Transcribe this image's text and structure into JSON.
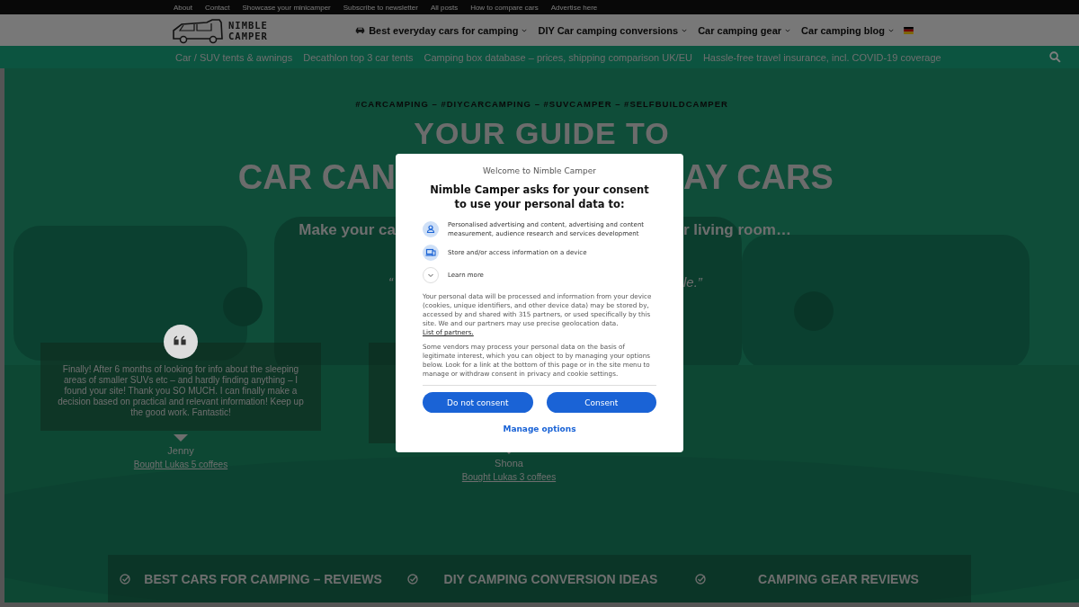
{
  "top_links": [
    "About",
    "Contact",
    "Showcase your minicamper",
    "Subscribe to newsletter",
    "All posts",
    "How to compare cars",
    "Advertise here"
  ],
  "logo": {
    "line1": "NIMBLE",
    "line2": "CAMPER"
  },
  "main_nav": [
    {
      "label": "Best everyday cars for camping",
      "has_icon": true
    },
    {
      "label": "DIY Car camping conversions",
      "has_icon": false
    },
    {
      "label": "Car camping gear",
      "has_icon": false
    },
    {
      "label": "Car camping blog",
      "has_icon": false
    }
  ],
  "sub_nav": [
    "Car / SUV tents & awnings",
    "Decathlon top 3 car tents",
    "Camping box database – prices, shipping comparison UK/EU",
    "Hassle-free travel insurance, incl. COVID-19 coverage"
  ],
  "hero": {
    "hashtags": "#CARCAMPING – #DIYCARCAMPING – #SUVCAMPER – #SELFBUILDCAMPER",
    "title_line1": "YOUR GUIDE TO",
    "title_line2_left": "CAR CAN",
    "title_line2_right": "AY CARS",
    "subtitle_left": "Make your ca",
    "subtitle_right": "r living room…",
    "quote_left": "“",
    "quote_right": "le.”"
  },
  "testimonials": [
    {
      "text": "Finally! After 6 months of looking for info about the sleeping areas of smaller SUVs etc – and hardly finding anything – I found your site! Thank you SO MUCH. I can finally make a decision based on practical and relevant information! Keep up the good work. Fantastic!",
      "author": "Jenny",
      "link": "Bought Lukas 5 coffees"
    },
    {
      "author": "Shona",
      "link": "Bought Lukas 3 coffees"
    }
  ],
  "features": [
    "BEST CARS FOR CAMPING – REVIEWS",
    "DIY CAMPING CONVERSION IDEAS",
    "CAMPING GEAR REVIEWS"
  ],
  "consent": {
    "welcome": "Welcome to Nimble Camper",
    "heading": "Nimble Camper asks for your consent to use your personal data to:",
    "purposes": [
      {
        "kind": "person",
        "text": "Personalised advertising and content, advertising and content measurement, audience research and services development"
      },
      {
        "kind": "device",
        "text": "Store and/or access information on a device"
      },
      {
        "kind": "expand",
        "text": "Learn more"
      }
    ],
    "paragraph_1": "Your personal data will be processed and information from your device (cookies, unique identifiers, and other device data) may be stored by, accessed by and shared with 315 partners, or used specifically by this site. We and our partners may use precise geolocation data.",
    "partners_link": "List of partners.",
    "paragraph_2": "Some vendors may process your personal data on the basis of legitimate interest, which you can object to by managing your options below. Look for a link at the bottom of this page or in the site menu to manage or withdraw consent in privacy and cookie settings.",
    "buttons": [
      "Do not consent",
      "Consent"
    ],
    "manage": "Manage options"
  }
}
